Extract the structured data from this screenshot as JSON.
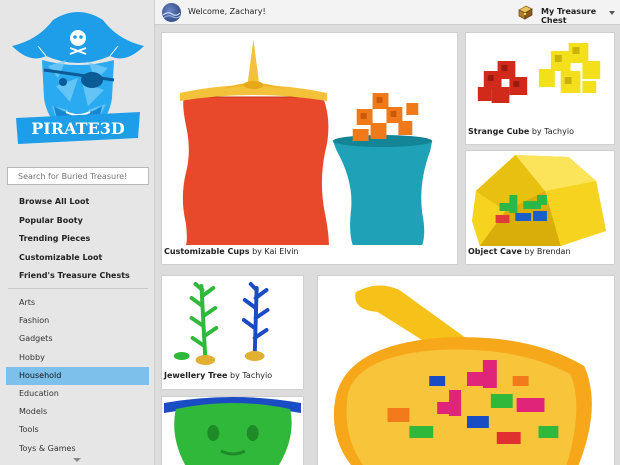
{
  "sidebar": {
    "search": {
      "placeholder": "Search for Buried Treasure!"
    },
    "main_items": [
      {
        "label": "Browse All Loot"
      },
      {
        "label": "Popular Booty"
      },
      {
        "label": "Trending Pieces"
      },
      {
        "label": "Customizable Loot"
      },
      {
        "label": "Friend's Treasure Chests"
      }
    ],
    "categories": [
      {
        "label": "Arts"
      },
      {
        "label": "Fashion"
      },
      {
        "label": "Gadgets"
      },
      {
        "label": "Hobby"
      },
      {
        "label": "Household",
        "active": true
      },
      {
        "label": "Education"
      },
      {
        "label": "Models"
      },
      {
        "label": "Tools"
      },
      {
        "label": "Toys & Games"
      }
    ]
  },
  "logo": {
    "text": "PIRATE3D",
    "color": "#1e9ee8"
  },
  "header": {
    "welcome": "Welcome, Zachary!",
    "my_chest": "My Treasure Chest"
  },
  "cards": [
    {
      "name": "Customizable Cups",
      "by": "by",
      "author": "Kai Elvin"
    },
    {
      "name": "Strange Cube",
      "by": "by",
      "author": "Tachyio"
    },
    {
      "name": "Object Cave",
      "by": "by",
      "author": "Brendan"
    },
    {
      "name": "Jewellery Tree",
      "by": "by",
      "author": "Tachyio"
    }
  ],
  "colors": {
    "accent": "#7ec0ec",
    "background": "#dcdcdc"
  }
}
